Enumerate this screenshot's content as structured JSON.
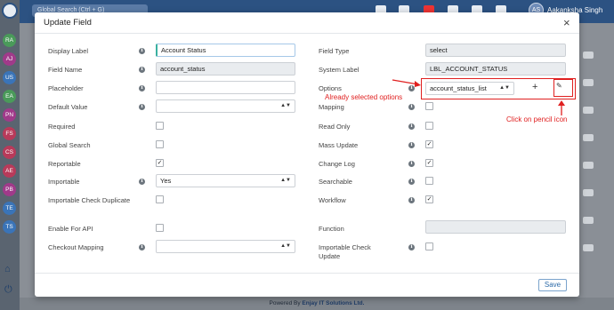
{
  "topbar": {
    "search_placeholder": "Global Search (Ctrl + G)",
    "user_initials": "AS",
    "user_name": "Aakanksha Singh"
  },
  "sidebar_avatars": [
    {
      "initials": "RA",
      "color": "#4a9a5a"
    },
    {
      "initials": "AJ",
      "color": "#a03a8a"
    },
    {
      "initials": "US",
      "color": "#3a74b8"
    },
    {
      "initials": "EA",
      "color": "#4a9a5a"
    },
    {
      "initials": "PN",
      "color": "#a03a8a"
    },
    {
      "initials": "FS",
      "color": "#b83a5a"
    },
    {
      "initials": "CS",
      "color": "#b83a5a"
    },
    {
      "initials": "AE",
      "color": "#b83a5a"
    },
    {
      "initials": "PB",
      "color": "#a03a8a"
    },
    {
      "initials": "TE",
      "color": "#3a74b8"
    },
    {
      "initials": "TS",
      "color": "#3a74b8"
    }
  ],
  "footer": {
    "powered_by": "Powered By ",
    "company": "Enjay IT Solutions Ltd."
  },
  "modal": {
    "title": "Update Field",
    "close_glyph": "×",
    "save_label": "Save"
  },
  "left_fields": {
    "display_label": {
      "label": "Display Label",
      "value": "Account Status"
    },
    "field_name": {
      "label": "Field Name",
      "value": "account_status"
    },
    "placeholder": {
      "label": "Placeholder",
      "value": ""
    },
    "default_value": {
      "label": "Default Value",
      "value": ""
    },
    "required": {
      "label": "Required",
      "checked": false
    },
    "global_search": {
      "label": "Global Search",
      "checked": false
    },
    "reportable": {
      "label": "Reportable",
      "checked": true
    },
    "importable": {
      "label": "Importable",
      "value": "Yes"
    },
    "importable_check_duplicate": {
      "label": "Importable Check Duplicate",
      "checked": false
    },
    "enable_for_api": {
      "label": "Enable For API",
      "checked": false
    },
    "checkout_mapping": {
      "label": "Checkout Mapping",
      "value": ""
    }
  },
  "right_fields": {
    "field_type": {
      "label": "Field Type",
      "value": "select"
    },
    "system_label": {
      "label": "System Label",
      "value": "LBL_ACCOUNT_STATUS"
    },
    "options": {
      "label": "Options",
      "value": "account_status_list",
      "add_glyph": "+"
    },
    "mapping": {
      "label": "Mapping",
      "checked": false
    },
    "read_only": {
      "label": "Read Only",
      "checked": false
    },
    "mass_update": {
      "label": "Mass Update",
      "checked": true
    },
    "change_log": {
      "label": "Change Log",
      "checked": true
    },
    "searchable": {
      "label": "Searchable",
      "checked": false
    },
    "workflow": {
      "label": "Workflow",
      "checked": true
    },
    "function": {
      "label": "Function",
      "value": ""
    },
    "importable_check_update": {
      "label": "Importable Check Update",
      "checked": false
    }
  },
  "annotations": {
    "already_selected": "Already selected options",
    "click_pencil": "Click on pencil icon",
    "color": "#e02020"
  },
  "icons": {
    "info": "info-icon",
    "pencil": "pencil-icon",
    "caret": "caret-down-icon"
  }
}
